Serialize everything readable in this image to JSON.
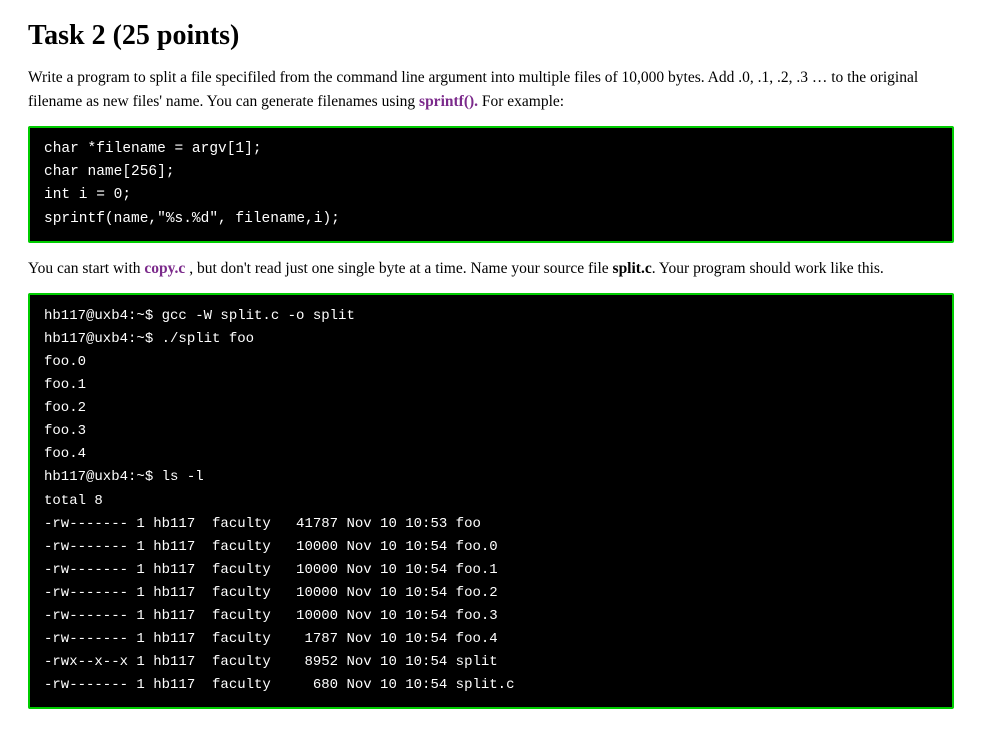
{
  "page": {
    "title": "Task 2 (25 points)",
    "description_part1": "Write a program to split a file specifiled from the command line argument into multiple files of 10,000 bytes. Add .0, .1, .2, .3 … to the original filename as new files' name. You can generate filenames using ",
    "sprintf_link_text": "sprintf().",
    "description_part2": " For example:",
    "code_example": "char *filename = argv[1];\nchar name[256];\nint i = 0;\nsprintf(name,\"%s.%d\", filename,i);",
    "description2_part1": "You can start with ",
    "copy_link_text": "copy.c",
    "description2_part2": " , but don't read just one single byte at a time. Name your source file ",
    "split_bold": "split.c",
    "description2_part3": ". Your program should work like this.",
    "terminal_output": "hb117@uxb4:~$ gcc -W split.c -o split\nhb117@uxb4:~$ ./split foo\nfoo.0\nfoo.1\nfoo.2\nfoo.3\nfoo.4\nhb117@uxb4:~$ ls -l\ntotal 8\n-rw------- 1 hb117  faculty   41787 Nov 10 10:53 foo\n-rw------- 1 hb117  faculty   10000 Nov 10 10:54 foo.0\n-rw------- 1 hb117  faculty   10000 Nov 10 10:54 foo.1\n-rw------- 1 hb117  faculty   10000 Nov 10 10:54 foo.2\n-rw------- 1 hb117  faculty   10000 Nov 10 10:54 foo.3\n-rw------- 1 hb117  faculty    1787 Nov 10 10:54 foo.4\n-rwx--x--x 1 hb117  faculty    8952 Nov 10 10:54 split\n-rw------- 1 hb117  faculty     680 Nov 10 10:54 split.c"
  }
}
